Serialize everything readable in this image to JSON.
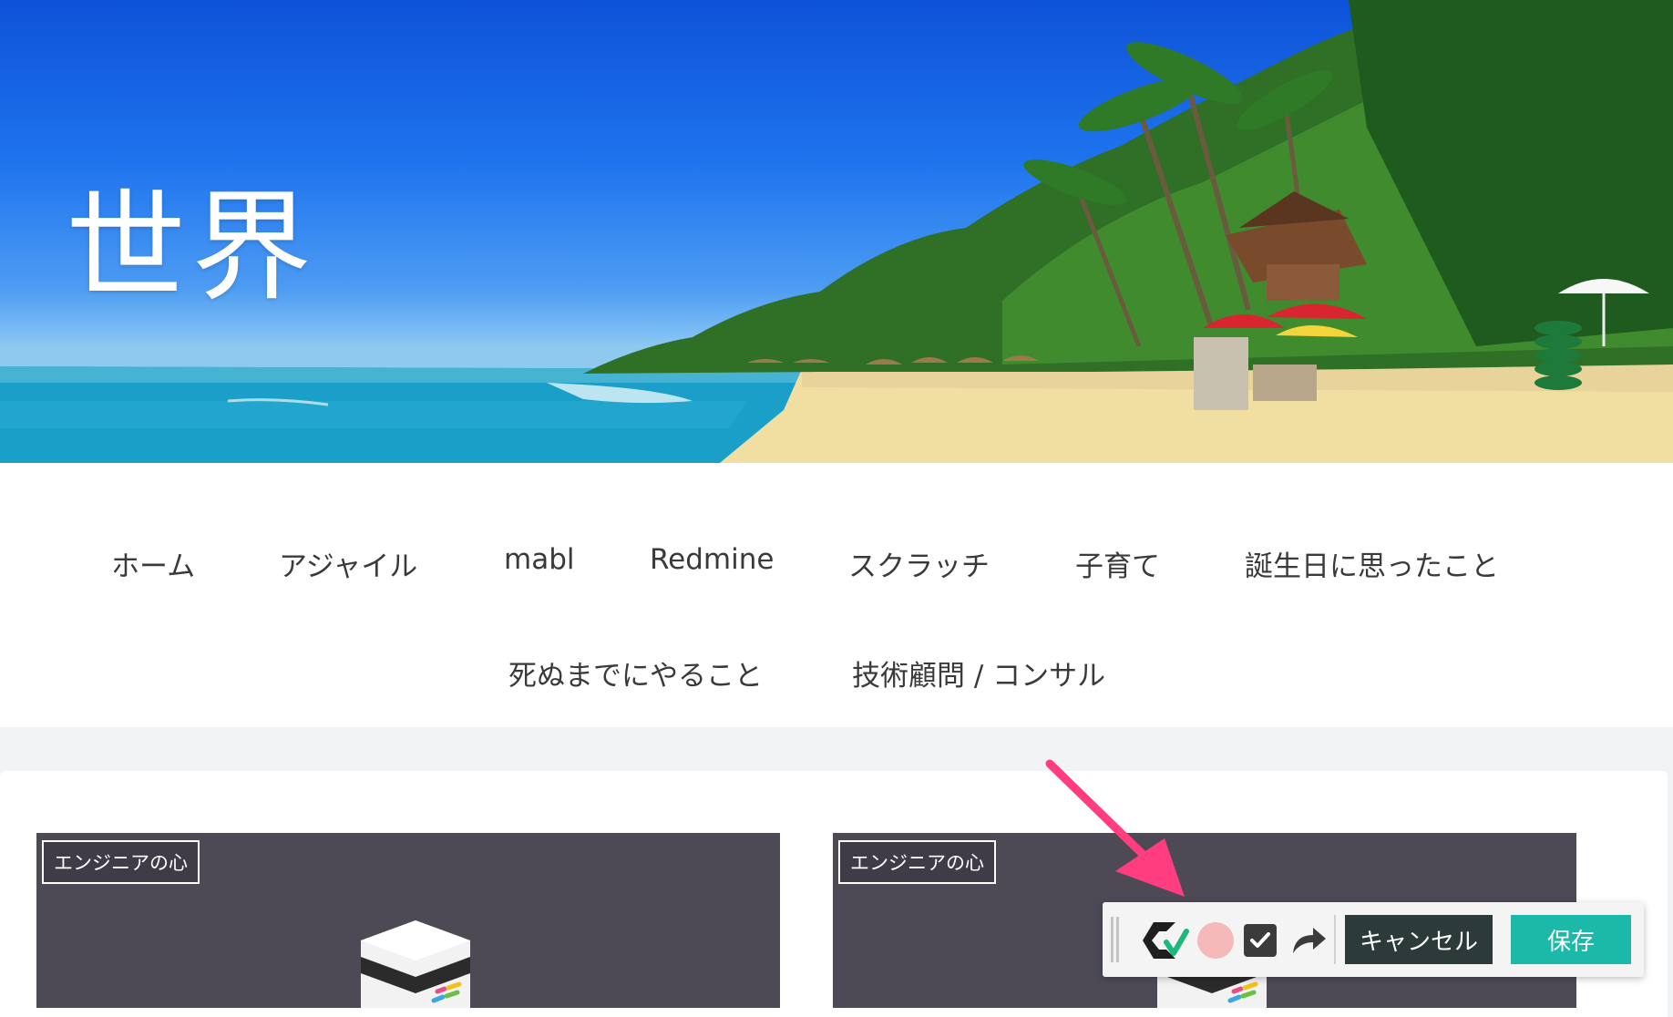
{
  "site": {
    "title": "世界"
  },
  "nav": {
    "items": [
      {
        "label": "ホーム"
      },
      {
        "label": "アジャイル"
      },
      {
        "label": "mabl"
      },
      {
        "label": "Redmine"
      },
      {
        "label": "スクラッチ"
      },
      {
        "label": "子育て"
      },
      {
        "label": "誕生日に思ったこと"
      },
      {
        "label": "死ぬまでにやること"
      },
      {
        "label": "技術顧問 / コンサル"
      }
    ]
  },
  "posts": [
    {
      "category": "エンジニアの心"
    },
    {
      "category": "エンジニアの心"
    }
  ],
  "toolbar": {
    "cancel_label": "キャンセル",
    "save_label": "保存",
    "icons": [
      "grip-handle-icon",
      "mabl-logo-icon",
      "record-dot-icon",
      "checkbox-icon",
      "redo-arrow-icon"
    ]
  },
  "colors": {
    "accent_save": "#1cb8a8",
    "cancel_bg": "#2d3a3a",
    "record_dot": "#f5b9b9",
    "arrow": "#ff3d7f",
    "card_bg": "#4d4a56"
  }
}
